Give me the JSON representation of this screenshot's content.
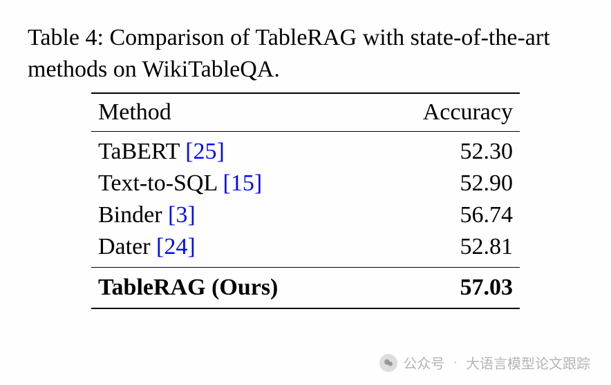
{
  "caption": "Table 4: Comparison of TableRAG with state-of-the-art methods on WikiTableQA.",
  "headers": {
    "method": "Method",
    "accuracy": "Accuracy"
  },
  "rows": [
    {
      "name": "TaBERT",
      "cite": "[25]",
      "accuracy": "52.30",
      "bold": false
    },
    {
      "name": "Text-to-SQL",
      "cite": "[15]",
      "accuracy": "52.90",
      "bold": false
    },
    {
      "name": "Binder",
      "cite": "[3]",
      "accuracy": "56.74",
      "bold": false
    },
    {
      "name": "Dater",
      "cite": "[24]",
      "accuracy": "52.81",
      "bold": false
    }
  ],
  "final_row": {
    "name": "TableRAG (Ours)",
    "cite": "",
    "accuracy": "57.03",
    "bold": true
  },
  "watermark": {
    "source_label": "公众号",
    "name": "大语言模型论文跟踪"
  },
  "chart_data": {
    "type": "table",
    "title": "Comparison of TableRAG with state-of-the-art methods on WikiTableQA",
    "columns": [
      "Method",
      "Accuracy"
    ],
    "rows": [
      [
        "TaBERT [25]",
        52.3
      ],
      [
        "Text-to-SQL [15]",
        52.9
      ],
      [
        "Binder [3]",
        56.74
      ],
      [
        "Dater [24]",
        52.81
      ],
      [
        "TableRAG (Ours)",
        57.03
      ]
    ]
  }
}
